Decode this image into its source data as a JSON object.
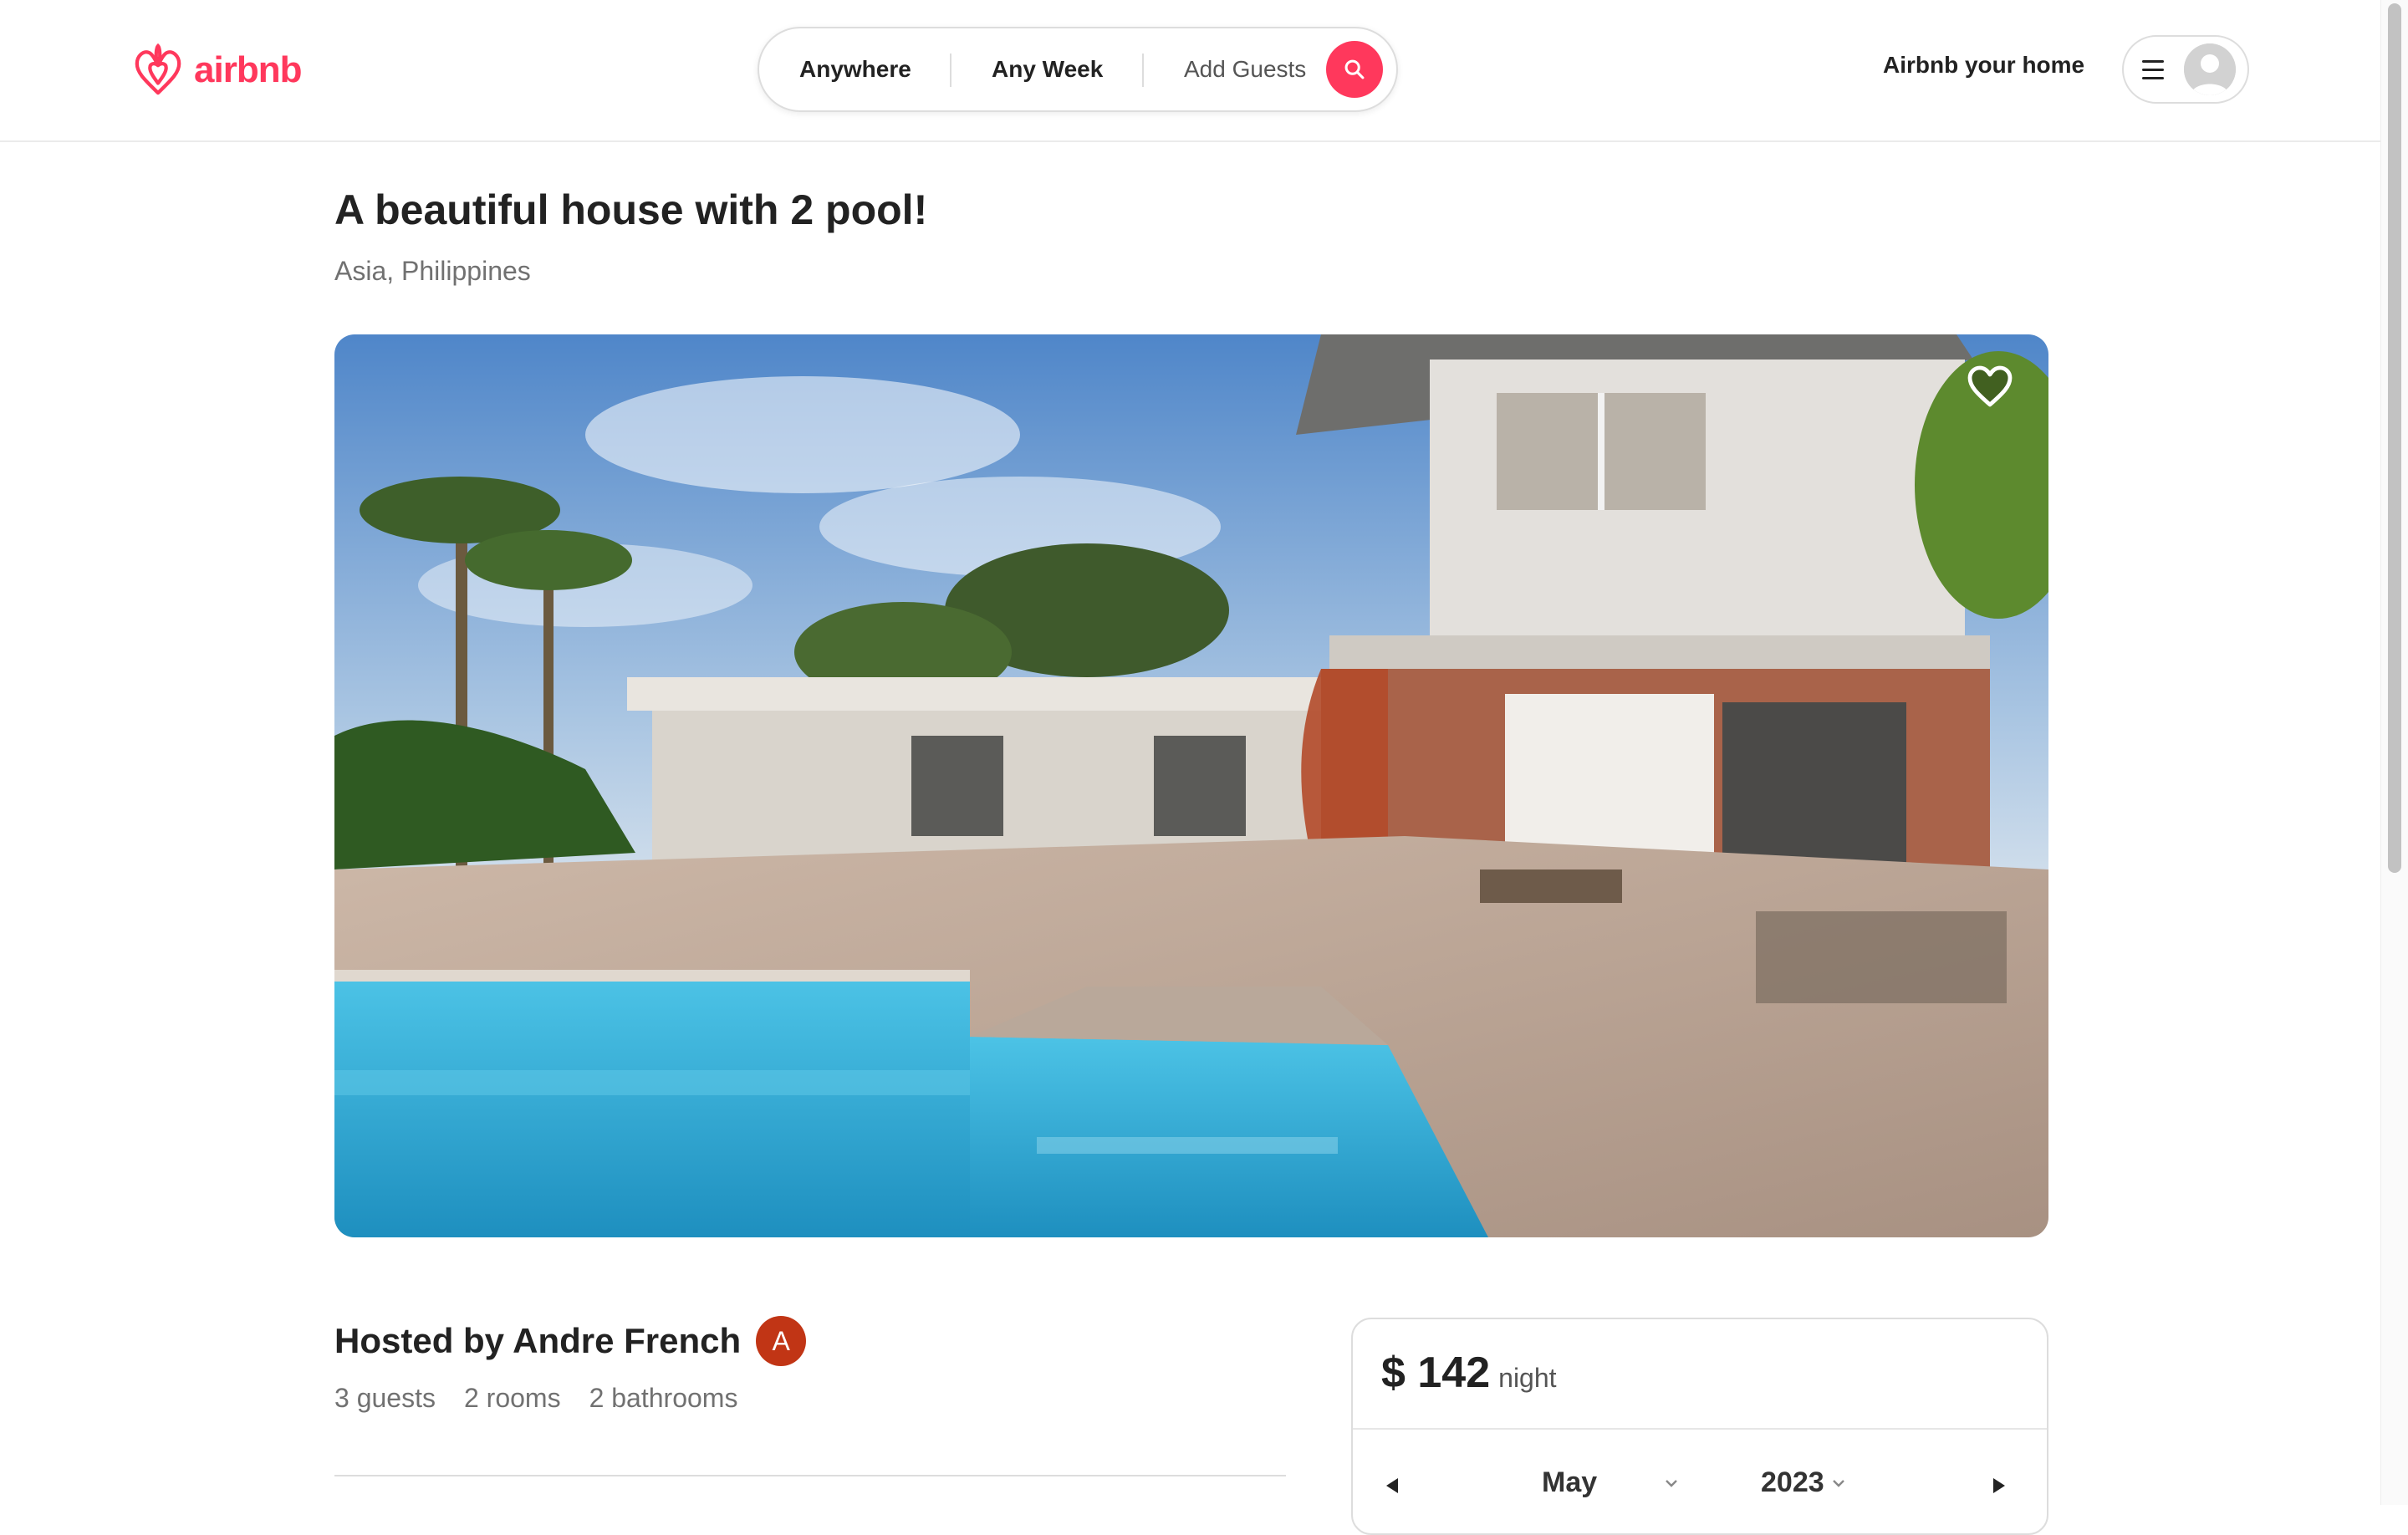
{
  "brand": {
    "name": "airbnb",
    "color": "#ff385c",
    "icon": "airbnb-logo-icon"
  },
  "search": {
    "anywhere": "Anywhere",
    "any_week": "Any Week",
    "add_guests": "Add Guests",
    "icon": "search-icon"
  },
  "header": {
    "host_link": "Airbnb your home",
    "menu_icon": "hamburger-icon",
    "avatar_icon": "user-avatar-icon"
  },
  "listing": {
    "title": "A beautiful house with 2 pool!",
    "location": "Asia, Philippines",
    "favorite_icon": "heart-icon",
    "host": {
      "label": "Hosted by Andre French",
      "initial": "A",
      "avatar_color": "#c13515"
    },
    "stats": [
      "3 guests",
      "2 rooms",
      "2 bathrooms"
    ]
  },
  "booking": {
    "price": "$ 142",
    "unit": "night",
    "calendar": {
      "month": "May",
      "year": "2023"
    }
  }
}
